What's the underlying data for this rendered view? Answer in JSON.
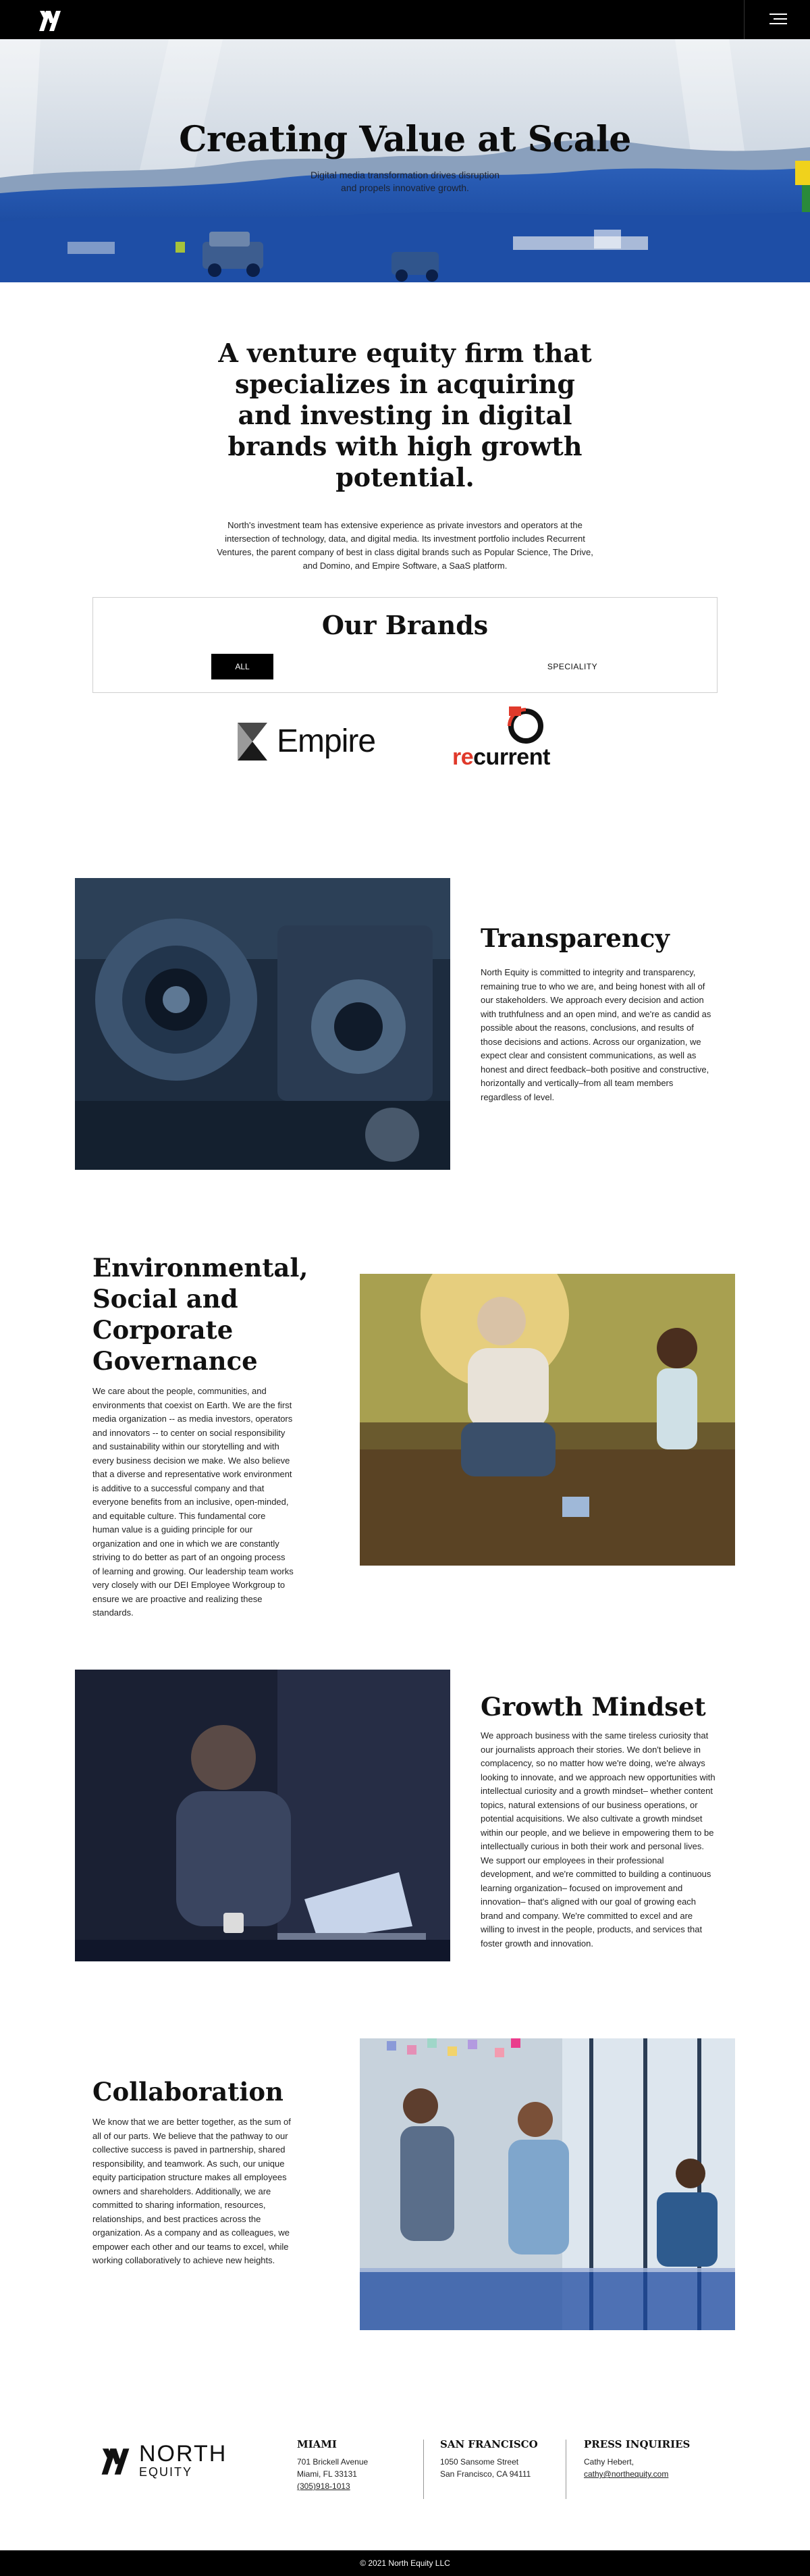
{
  "header": {
    "logo_icon": "north-equity-monogram-icon",
    "menu_icon": "hamburger-menu-icon"
  },
  "hero": {
    "title": "Creating Value at Scale",
    "subtitle_line1": "Digital media transformation drives disruption",
    "subtitle_line2": "and propels innovative growth."
  },
  "intro": {
    "heading": "A venture equity firm that specializes in acquiring and investing in digital brands with high growth potential.",
    "body": "North's investment team has extensive experience as private investors and operators at the intersection of technology, data, and digital media. Its investment portfolio includes Recurrent Ventures, the parent company of best in class digital brands such as Popular Science, The Drive, and Domino, and Empire Software, a SaaS platform."
  },
  "brands": {
    "title": "Our Brands",
    "tabs": [
      {
        "label": "ALL",
        "active": true
      },
      {
        "label": "SPECIALITY",
        "active": false
      }
    ],
    "empire_name": "Empire",
    "recurrent_prefix": "re",
    "recurrent_suffix": "current"
  },
  "sections": {
    "transparency": {
      "title": "Transparency",
      "body": "North Equity is committed to integrity and transparency, remaining true to who we are, and being honest with all of our stakeholders. We approach every decision and action with truthfulness and an open mind, and we're as candid as possible about the reasons, conclusions, and results of those decisions and actions. Across our organization, we expect clear and consistent communications, as well as honest and direct feedback–both positive and constructive, horizontally and vertically–from all team members regardless of level."
    },
    "esg": {
      "title_line1": "Environmental,",
      "title_line2": "Social and",
      "title_line3": "Corporate",
      "title_line4": "Governance",
      "body": "We care about the people, communities, and environments that coexist on Earth. We are the first media organization -- as media investors, operators and innovators -- to center on social responsibility and sustainability within our storytelling and with every business decision we make. We also believe that a diverse and representative work environment is additive to a successful company and that everyone benefits from an inclusive, open-minded, and equitable culture. This fundamental core human value is a guiding principle for our organization and one in which we are constantly striving to do better as part of an ongoing process of learning and growing. Our leadership team works very closely with our DEI Employee Workgroup to ensure we are proactive and realizing these standards."
    },
    "growth": {
      "title": "Growth Mindset",
      "body": "We approach business with the same tireless curiosity that our journalists approach their stories. We don't believe in complacency, so no matter how we're doing, we're always looking to innovate, and we approach new opportunities with intellectual curiosity and a growth mindset– whether content topics, natural extensions of our business operations, or potential acquisitions. We also cultivate a growth mindset within our people, and we believe in empowering them to be intellectually curious in both their work and personal lives. We support our employees in their professional development, and we're committed to building a continuous learning organization– focused on improvement and innovation– that's aligned with our goal of growing each brand and company. We're committed to excel and are willing to invest in the people, products, and services that foster growth and innovation."
    },
    "collaboration": {
      "title": "Collaboration",
      "body": "We know that we are better together, as the sum of all of our parts. We believe that the pathway to our collective success is paved in partnership, shared responsibility, and teamwork. As such, our unique equity participation structure makes all employees owners and shareholders. Additionally, we are committed to sharing information, resources, relationships, and best practices across the organization. As a company and as colleagues, we empower each other and our teams to excel, while working collaboratively to achieve new heights."
    }
  },
  "footer": {
    "logo_word": "NORTH",
    "logo_sub": "EQUITY",
    "miami": {
      "title": "MIAMI",
      "line1": "701 Brickell Avenue",
      "line2": "Miami, FL 33131",
      "phone": "(305)918-1013"
    },
    "sf": {
      "title": "SAN FRANCISCO",
      "line1": "1050 Sansome Street",
      "line2": "San Francisco, CA 94111"
    },
    "press": {
      "title": "PRESS INQUIRIES",
      "name": "Cathy Hebert,",
      "email": "cathy@northequity.com"
    },
    "copyright": "© 2021 North Equity LLC"
  }
}
